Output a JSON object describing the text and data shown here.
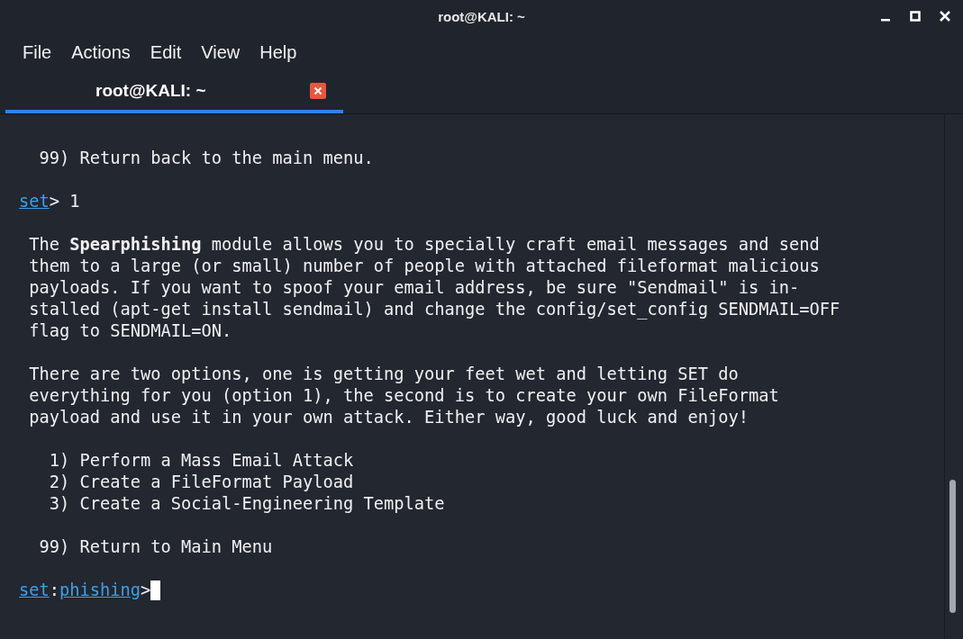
{
  "window": {
    "title": "root@KALI: ~"
  },
  "menu": [
    "File",
    "Actions",
    "Edit",
    "View",
    "Help"
  ],
  "tabs": [
    {
      "label": "root@KALI: ~",
      "selected": true
    }
  ],
  "terminal": {
    "lines": [
      {
        "kind": "blank"
      },
      {
        "kind": "text",
        "segments": [
          {
            "kind": "text",
            "text": "  99) Return back to the main menu."
          }
        ]
      },
      {
        "kind": "blank"
      },
      {
        "kind": "text",
        "segments": [
          {
            "kind": "link",
            "text": "set"
          },
          {
            "kind": "text",
            "text": "> 1"
          }
        ]
      },
      {
        "kind": "blank"
      },
      {
        "kind": "text",
        "segments": [
          {
            "kind": "text",
            "text": " The **Spearphishing** module allows you to specially craft email messages and send"
          }
        ]
      },
      {
        "kind": "text",
        "segments": [
          {
            "kind": "text",
            "text": " them to a large (or small) number of people with attached fileformat malicious"
          }
        ]
      },
      {
        "kind": "text",
        "segments": [
          {
            "kind": "text",
            "text": " payloads. If you want to spoof your email address, be sure \"Sendmail\" is in-"
          }
        ]
      },
      {
        "kind": "text",
        "segments": [
          {
            "kind": "text",
            "text": " stalled (apt-get install sendmail) and change the config/set_config SENDMAIL=OFF"
          }
        ]
      },
      {
        "kind": "text",
        "segments": [
          {
            "kind": "text",
            "text": " flag to SENDMAIL=ON."
          }
        ]
      },
      {
        "kind": "blank"
      },
      {
        "kind": "text",
        "segments": [
          {
            "kind": "text",
            "text": " There are two options, one is getting your feet wet and letting SET do"
          }
        ]
      },
      {
        "kind": "text",
        "segments": [
          {
            "kind": "text",
            "text": " everything for you (option 1), the second is to create your own FileFormat"
          }
        ]
      },
      {
        "kind": "text",
        "segments": [
          {
            "kind": "text",
            "text": " payload and use it in your own attack. Either way, good luck and enjoy!"
          }
        ]
      },
      {
        "kind": "blank"
      },
      {
        "kind": "text",
        "segments": [
          {
            "kind": "text",
            "text": "   1) Perform a Mass Email Attack"
          }
        ]
      },
      {
        "kind": "text",
        "segments": [
          {
            "kind": "text",
            "text": "   2) Create a FileFormat Payload"
          }
        ]
      },
      {
        "kind": "text",
        "segments": [
          {
            "kind": "text",
            "text": "   3) Create a Social-Engineering Template"
          }
        ]
      },
      {
        "kind": "blank"
      },
      {
        "kind": "text",
        "segments": [
          {
            "kind": "text",
            "text": "  99) Return to Main Menu"
          }
        ]
      },
      {
        "kind": "blank"
      },
      {
        "kind": "text",
        "cursor": true,
        "segments": [
          {
            "kind": "link",
            "text": "set"
          },
          {
            "kind": "text",
            "text": ":"
          },
          {
            "kind": "link",
            "text": "phishing"
          },
          {
            "kind": "text",
            "text": ">"
          }
        ]
      }
    ]
  }
}
